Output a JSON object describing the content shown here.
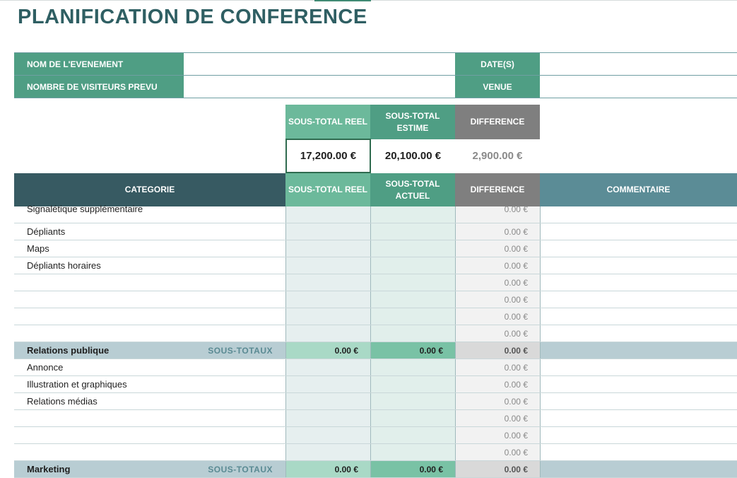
{
  "title": "PLANIFICATION DE CONFERENCE",
  "event_info": {
    "event_name_label": "NOM DE L'EVENEMENT",
    "visitors_label": "NOMBRE  DE VISITEURS PREVU",
    "dates_label": "DATE(S)",
    "venue_label": "VENUE"
  },
  "totals": {
    "headers": [
      "SOUS-TOTAL REEL",
      "SOUS-TOTAL ESTIME",
      "DIFFERENCE"
    ],
    "values": [
      "17,200.00 €",
      "20,100.00 €",
      "2,900.00 €"
    ]
  },
  "table": {
    "headers": {
      "category": "CATEGORIE",
      "reel": "SOUS-TOTAL REEL",
      "actuel": "SOUS-TOTAL ACTUEL",
      "difference": "DIFFERENCE",
      "comment": "COMMENTAIRE"
    },
    "subtotal_tag": "SOUS-TOTAUX",
    "rows": [
      {
        "category": "Signalétique supplémentaire",
        "difference": "0.00 €"
      },
      {
        "category": "Dépliants",
        "difference": "0.00 €"
      },
      {
        "category": "Maps",
        "difference": "0.00 €"
      },
      {
        "category": "Dépliants horaires",
        "difference": "0.00 €"
      },
      {
        "category": "",
        "difference": "0.00 €"
      },
      {
        "category": "",
        "difference": "0.00 €"
      },
      {
        "category": "",
        "difference": "0.00 €"
      },
      {
        "category": "",
        "difference": "0.00 €"
      },
      {
        "category": "Relations publique",
        "subtotal": true,
        "reel": "0.00 €",
        "actuel": "0.00 €",
        "difference": "0.00 €"
      },
      {
        "category": "Annonce",
        "difference": "0.00 €"
      },
      {
        "category": "Illustration et graphiques",
        "difference": "0.00 €"
      },
      {
        "category": "Relations médias",
        "difference": "0.00 €"
      },
      {
        "category": "",
        "difference": "0.00 €"
      },
      {
        "category": "",
        "difference": "0.00 €"
      },
      {
        "category": "",
        "difference": "0.00 €"
      },
      {
        "category": "Marketing",
        "subtotal": true,
        "reel": "0.00 €",
        "actuel": "0.00 €",
        "difference": "0.00 €"
      }
    ]
  },
  "colors": {
    "title": "#2f5f63",
    "label_green": "#4f9e84",
    "header_dark": "#375a62",
    "header_reel": "#6cb99b",
    "header_diff": "#7f7f7f",
    "header_comment": "#5b8c96"
  }
}
